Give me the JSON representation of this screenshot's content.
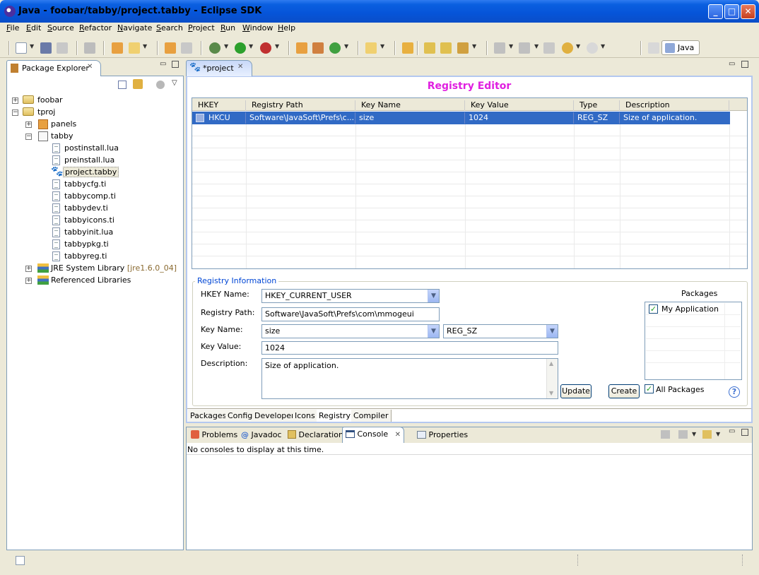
{
  "window": {
    "title": "Java - foobar/tabby/project.tabby - Eclipse SDK",
    "minimize": "_",
    "maximize": "□",
    "close": "✕"
  },
  "menu": [
    "File",
    "Edit",
    "Source",
    "Refactor",
    "Navigate",
    "Search",
    "Project",
    "Run",
    "Window",
    "Help"
  ],
  "perspective": {
    "label": "Java"
  },
  "package_explorer": {
    "tab_label": "Package Explorer",
    "items": [
      {
        "label": "foobar",
        "icon": "project-icon"
      },
      {
        "label": "tproj",
        "icon": "project-icon"
      },
      {
        "label": "panels",
        "icon": "package-icon"
      },
      {
        "label": "tabby",
        "icon": "package-icon"
      },
      {
        "label": "postinstall.lua",
        "icon": "file-icon"
      },
      {
        "label": "preinstall.lua",
        "icon": "file-icon"
      },
      {
        "label": "project.tabby",
        "icon": "paw-icon"
      },
      {
        "label": "tabbycfg.ti",
        "icon": "file-icon"
      },
      {
        "label": "tabbycomp.ti",
        "icon": "file-icon"
      },
      {
        "label": "tabbydev.ti",
        "icon": "file-icon"
      },
      {
        "label": "tabbyicons.ti",
        "icon": "file-icon"
      },
      {
        "label": "tabbyinit.lua",
        "icon": "file-icon"
      },
      {
        "label": "tabbypkg.ti",
        "icon": "file-icon"
      },
      {
        "label": "tabbyreg.ti",
        "icon": "file-icon"
      },
      {
        "label": "JRE System Library",
        "suffix": "[jre1.6.0_04]",
        "icon": "library-icon"
      },
      {
        "label": "Referenced Libraries",
        "icon": "library-icon"
      }
    ]
  },
  "editor": {
    "tab_label": "*project",
    "title": "Registry Editor",
    "title_color": "#e020e0",
    "table": {
      "columns": [
        "HKEY",
        "Registry Path",
        "Key Name",
        "Key Value",
        "Type",
        "Description"
      ],
      "rows": [
        [
          "HKCU",
          "Software\\JavaSoft\\Prefs\\c...",
          "size",
          "1024",
          "REG_SZ",
          "Size of application."
        ]
      ]
    },
    "registry_info": {
      "group_label": "Registry Information",
      "hkey_name_label": "HKEY Name:",
      "hkey_name_value": "HKEY_CURRENT_USER",
      "registry_path_label": "Registry Path:",
      "registry_path_value": "Software\\JavaSoft\\Prefs\\com\\mmogeui",
      "key_name_label": "Key Name:",
      "key_name_value": "size",
      "type_value": "REG_SZ",
      "key_value_label": "Key Value:",
      "key_value_value": "1024",
      "description_label": "Description:",
      "description_value": "Size of application.",
      "update_button": "Update",
      "create_button": "Create",
      "packages_label": "Packages",
      "packages": [
        {
          "label": "My Application",
          "checked": true
        }
      ],
      "all_packages_label": "All Packages",
      "help_icon": "?"
    },
    "bottom_tabs": [
      "Packages",
      "Config",
      "Developer",
      "Icons",
      "Registry",
      "Compiler"
    ],
    "active_bottom_tab": "Registry"
  },
  "console_view": {
    "tabs": [
      "Problems",
      "Javadoc",
      "Declaration",
      "Console",
      "Properties"
    ],
    "active_tab": "Console",
    "message": "No consoles to display at this time."
  }
}
